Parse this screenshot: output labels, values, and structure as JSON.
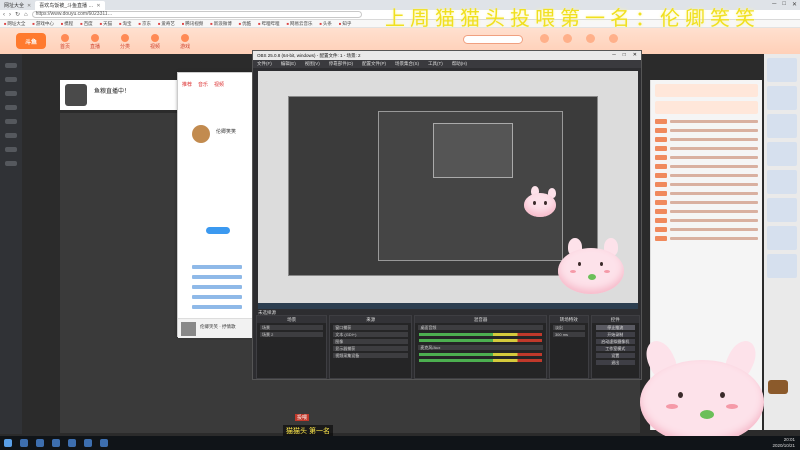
{
  "browser": {
    "tabs": [
      {
        "title": "网址大全",
        "active": false
      },
      {
        "title": "喜欢鸟饭被_斗鱼直播 …",
        "active": true
      }
    ],
    "url": "https://www.douyu.com/6023311…",
    "window_buttons": [
      "─",
      "□",
      "✕"
    ],
    "nav": [
      "‹",
      "›",
      "↻",
      "⌂"
    ],
    "bookmarks": [
      "网址大全",
      "游戏中心",
      "携程",
      "百度",
      "天猫",
      "淘宝",
      "京东",
      "爱奇艺",
      "腾讯视频",
      "新浪微博",
      "优酷",
      "哔哩哔哩",
      "网易云音乐",
      "头条",
      "知乎"
    ]
  },
  "site": {
    "logo": "斗鱼",
    "banner_text": "上周猫猫头投喂第一名：伦卿笑笑",
    "nav_items": [
      "首页",
      "直播",
      "分类",
      "视频",
      "游戏"
    ],
    "stream_title": "鱼粮直播中！",
    "subtitle_tag": "投喂",
    "subtitle_text": "猫猫头 第一名"
  },
  "music_app": {
    "tabs": [
      "推荐",
      "音乐",
      "视频"
    ],
    "user_name": "伦卿笑笑",
    "now_playing": "伦卿笑笑 · 抒情歌"
  },
  "obs": {
    "title": "OBS 25.0.8 (64-bit, windows) - 配置文件: 1 - 场景: 2",
    "menu": [
      "文件(F)",
      "编辑(E)",
      "视图(V)",
      "停靠部件(D)",
      "配置文件(P)",
      "场景集合(S)",
      "工具(T)",
      "帮助(H)"
    ],
    "preview_label": "未选择源",
    "docks": {
      "scenes": {
        "title": "场景",
        "items": [
          "场景",
          "场景 2"
        ]
      },
      "sources": {
        "title": "来源",
        "items": [
          "窗口捕获",
          "文本 (GDI+)",
          "图像",
          "显示器捕获",
          "视频采集设备"
        ]
      },
      "mixer": {
        "title": "混音器",
        "items": [
          "桌面音频",
          "麦克风/Aux"
        ]
      },
      "transitions": {
        "title": "转场特效",
        "items": [
          "淡出",
          "300 ms"
        ]
      },
      "controls": {
        "title": "控件",
        "buttons": [
          "停止推流",
          "开始录制",
          "启动虚拟摄像机",
          "工作室模式",
          "设置",
          "退出"
        ]
      }
    }
  },
  "taskbar": {
    "time": "20:01",
    "date": "2020/10/21"
  },
  "colors": {
    "accent": "#ff7a2e",
    "banner_text": "#f0e020",
    "obs_bg": "#2d2d30"
  }
}
